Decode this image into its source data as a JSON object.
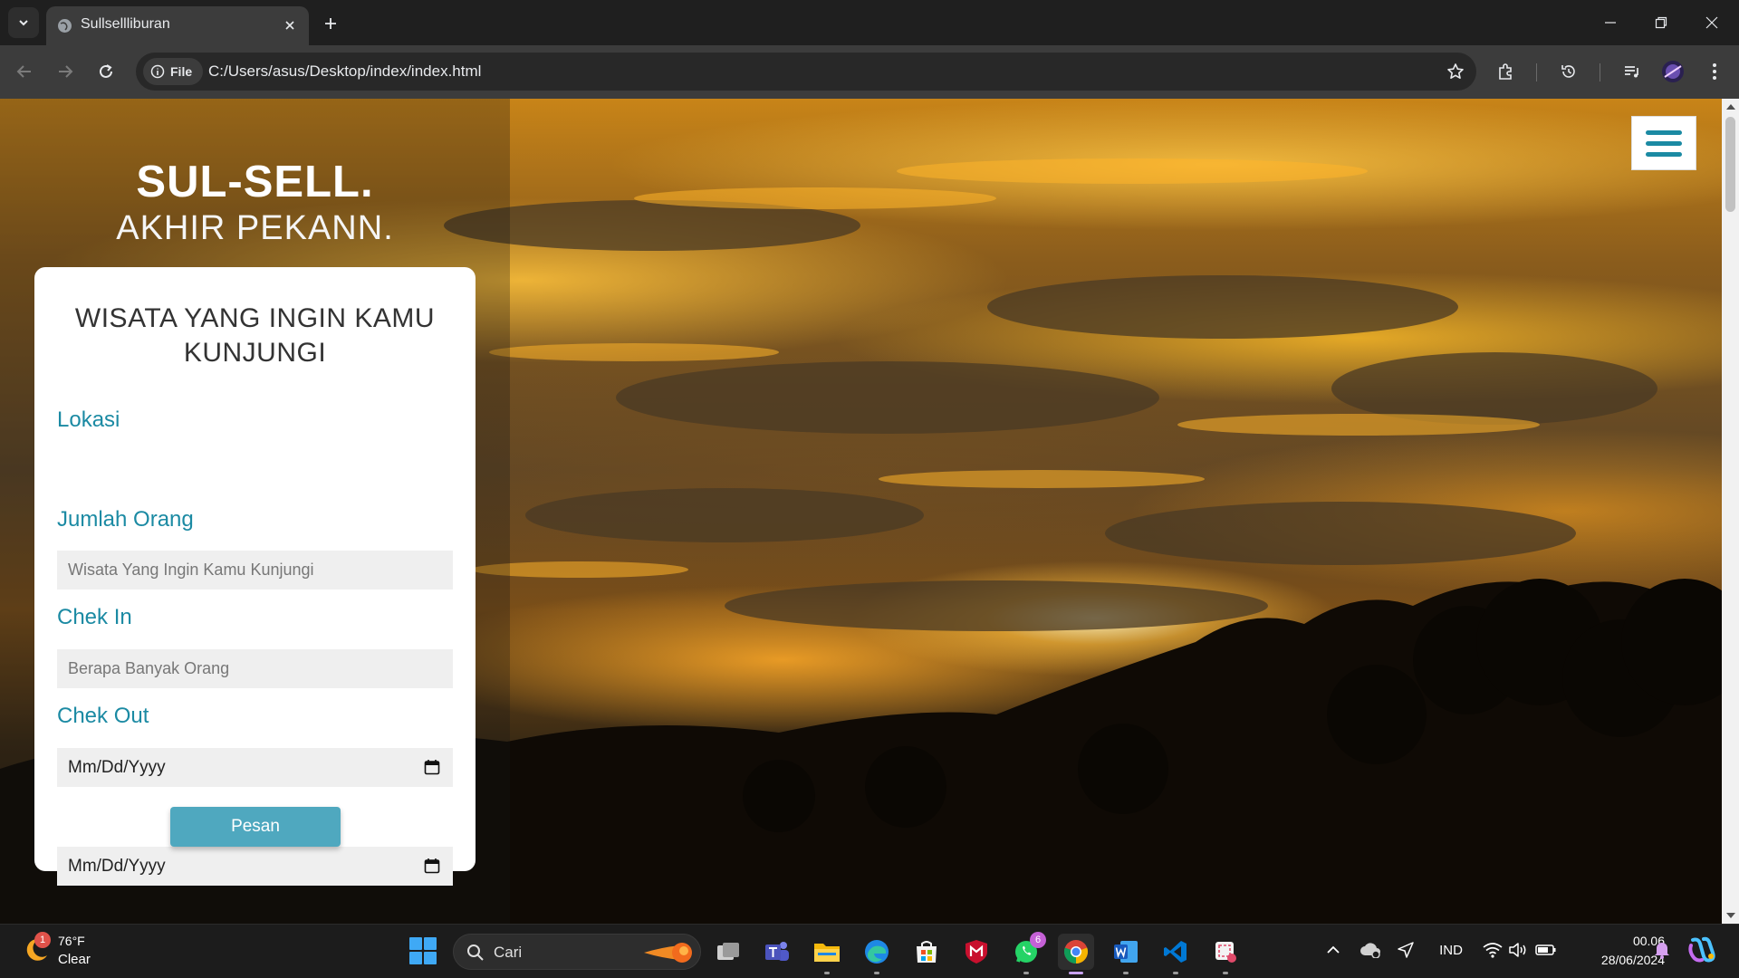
{
  "browser": {
    "tab_title": "Sullsellliburan",
    "address_chip": "File",
    "url": "C:/Users/asus/Desktop/index/index.html"
  },
  "page": {
    "brand": "SUL-SELL.",
    "brand_sub": "AKHIR PEKANN.",
    "form_title": "WISATA YANG INGIN KAMU KUNJUNGI",
    "fields": [
      {
        "label": "Lokasi",
        "placeholder": "Wisata Yang Ingin Kamu Kunjungi"
      },
      {
        "label": "Jumlah Orang",
        "placeholder": "Berapa Banyak Orang"
      },
      {
        "label": "Chek In",
        "value": "Mm/Dd/Yyyy"
      },
      {
        "label": "Chek Out",
        "value": "Mm/Dd/Yyyy"
      }
    ],
    "submit_label": "Pesan"
  },
  "taskbar": {
    "weather_badge": "1",
    "temperature": "76°F",
    "condition": "Clear",
    "search_placeholder": "Cari",
    "whatsapp_badge": "6",
    "language": "IND",
    "time": "00.06",
    "date": "28/06/2024"
  },
  "colors": {
    "accent": "#1b8aa3",
    "button": "#4fa8bf",
    "chrome_dark": "#1f1f1f",
    "chrome_toolbar": "#3c3c3c"
  }
}
